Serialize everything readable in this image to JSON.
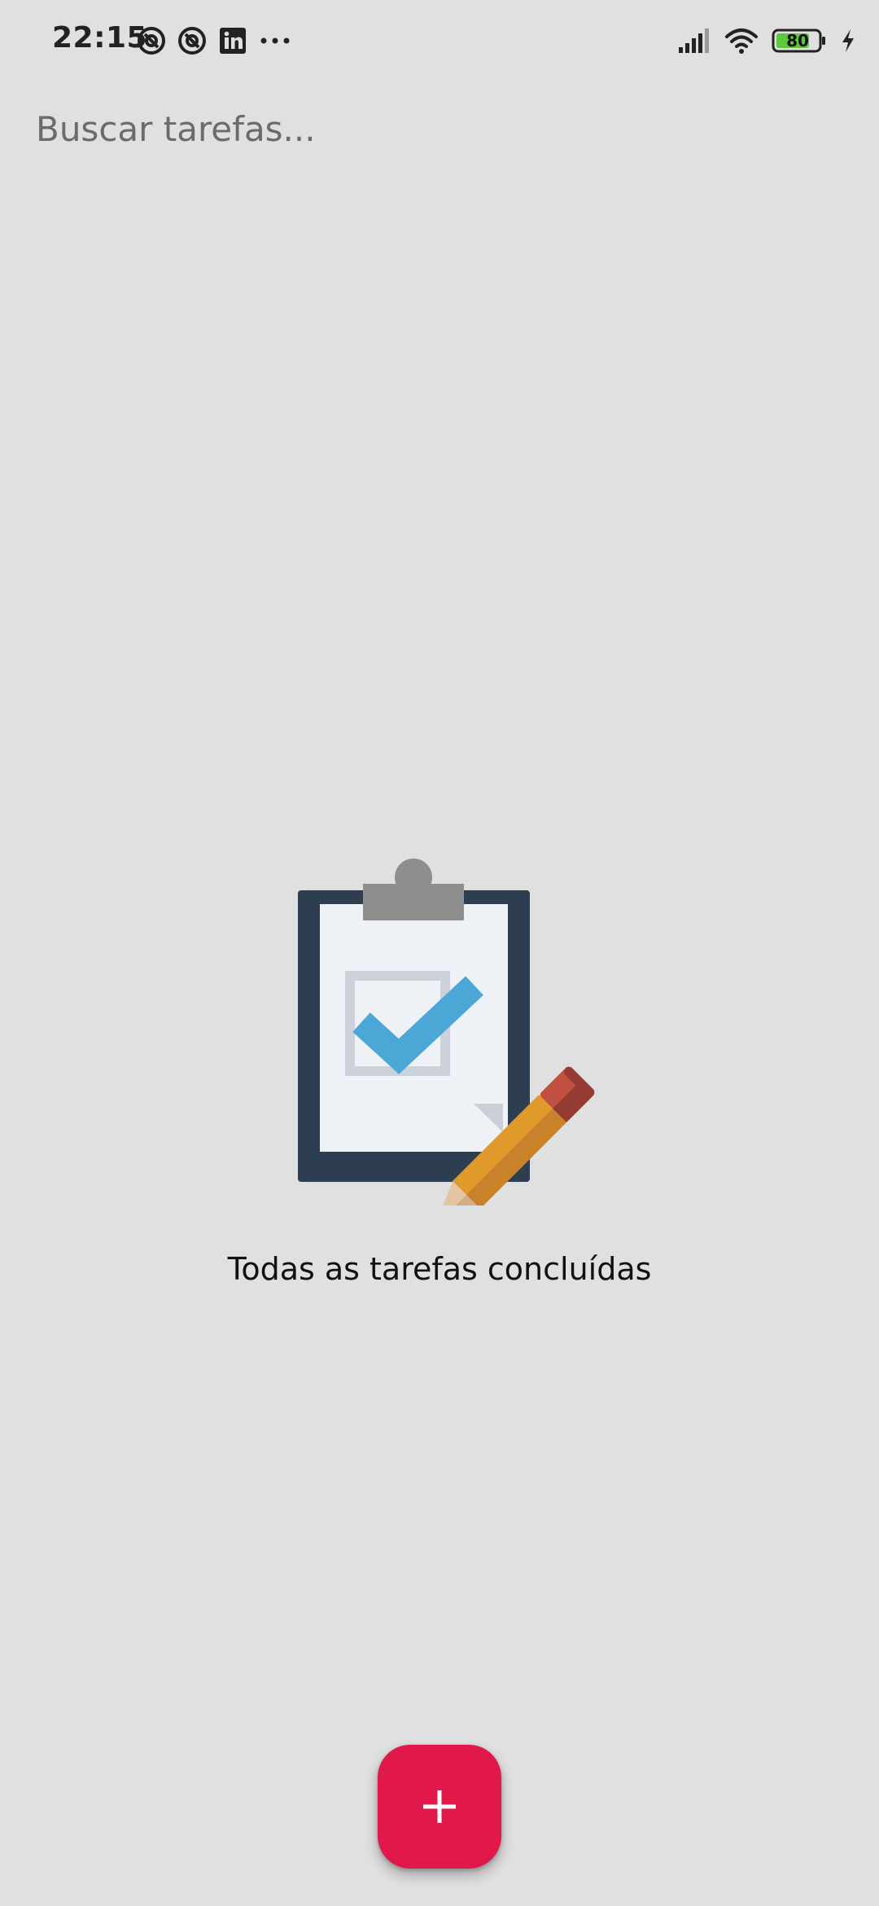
{
  "status_bar": {
    "time": "22:15",
    "battery_level": "80",
    "left_icons": [
      "notification-icon",
      "notification-icon",
      "linkedin-icon",
      "more-dots-icon"
    ],
    "right_icons": [
      "signal-icon",
      "wifi-icon",
      "battery-icon",
      "charging-icon"
    ],
    "colors": {
      "battery_fill": "#5cc83a"
    }
  },
  "search": {
    "placeholder": "Buscar tarefas...",
    "value": ""
  },
  "empty_state": {
    "illustration": "clipboard-check-pencil",
    "message": "Todas as tarefas concluídas"
  },
  "fab": {
    "icon": "plus-icon",
    "color": "#e0194a"
  }
}
